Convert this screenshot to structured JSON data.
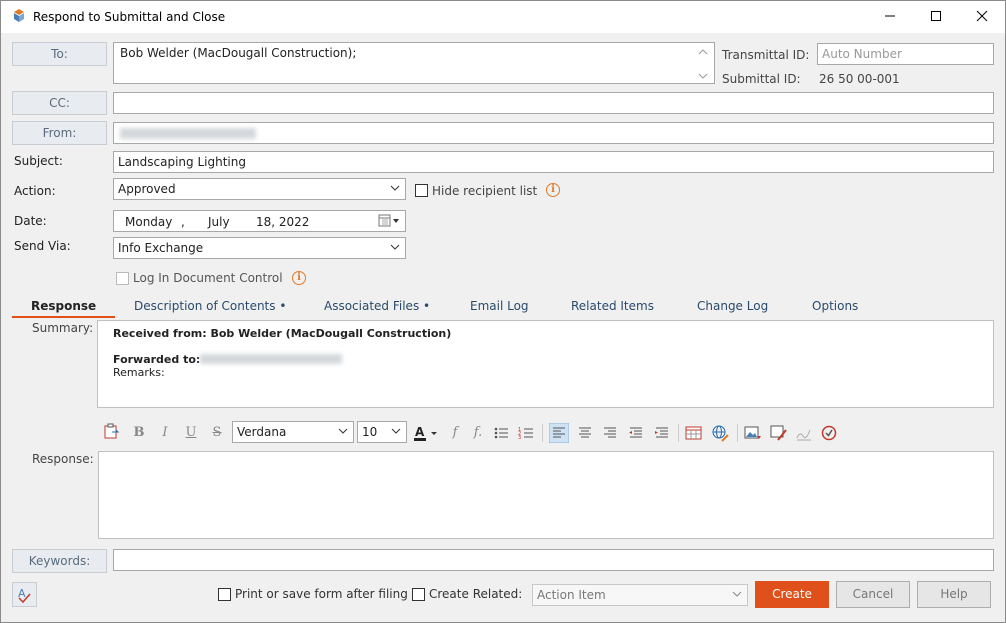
{
  "window": {
    "title": "Respond to Submittal and Close",
    "minimize_icon": "minimize-icon",
    "maximize_icon": "maximize-icon",
    "close_icon": "close-icon"
  },
  "form": {
    "to_label": "To:",
    "to_value": "Bob Welder (MacDougall Construction);",
    "cc_label": "CC:",
    "cc_value": "",
    "from_label": "From:",
    "from_value": "",
    "subject_label": "Subject:",
    "subject_value": "Landscaping Lighting",
    "action_label": "Action:",
    "action_value": "Approved",
    "hide_recipient_label": "Hide recipient list",
    "date_label": "Date:",
    "date_weekday": "Monday",
    "date_month": "July",
    "date_day_year": "18, 2022",
    "send_via_label": "Send Via:",
    "send_via_value": "Info Exchange",
    "log_in_doc_label": "Log In Document Control",
    "transmittal_id_label": "Transmittal ID:",
    "transmittal_id_placeholder": "Auto Number",
    "submittal_id_label": "Submittal ID:",
    "submittal_id_value": "26 50 00-001"
  },
  "tabs": [
    {
      "label": "Response"
    },
    {
      "label": "Description of Contents •"
    },
    {
      "label": "Associated Files •"
    },
    {
      "label": "Email Log"
    },
    {
      "label": "Related Items"
    },
    {
      "label": "Change Log"
    },
    {
      "label": "Options"
    }
  ],
  "summary": {
    "label": "Summary:",
    "received_from": "Received from: Bob Welder (MacDougall Construction)",
    "forwarded_to": "Forwarded to:",
    "remarks": "Remarks:"
  },
  "editor": {
    "font_value": "Verdana",
    "size_value": "10",
    "response_label": "Response:"
  },
  "keywords": {
    "label": "Keywords:",
    "value": ""
  },
  "footer": {
    "print_label": "Print or save form after filing",
    "create_related_label": "Create Related:",
    "create_related_value": "Action Item",
    "create_button": "Create",
    "cancel_button": "Cancel",
    "help_button": "Help"
  },
  "colors": {
    "accent": "#e0501a",
    "tab_underline": "#e0501a",
    "label_button_text": "#5a6b7c"
  }
}
